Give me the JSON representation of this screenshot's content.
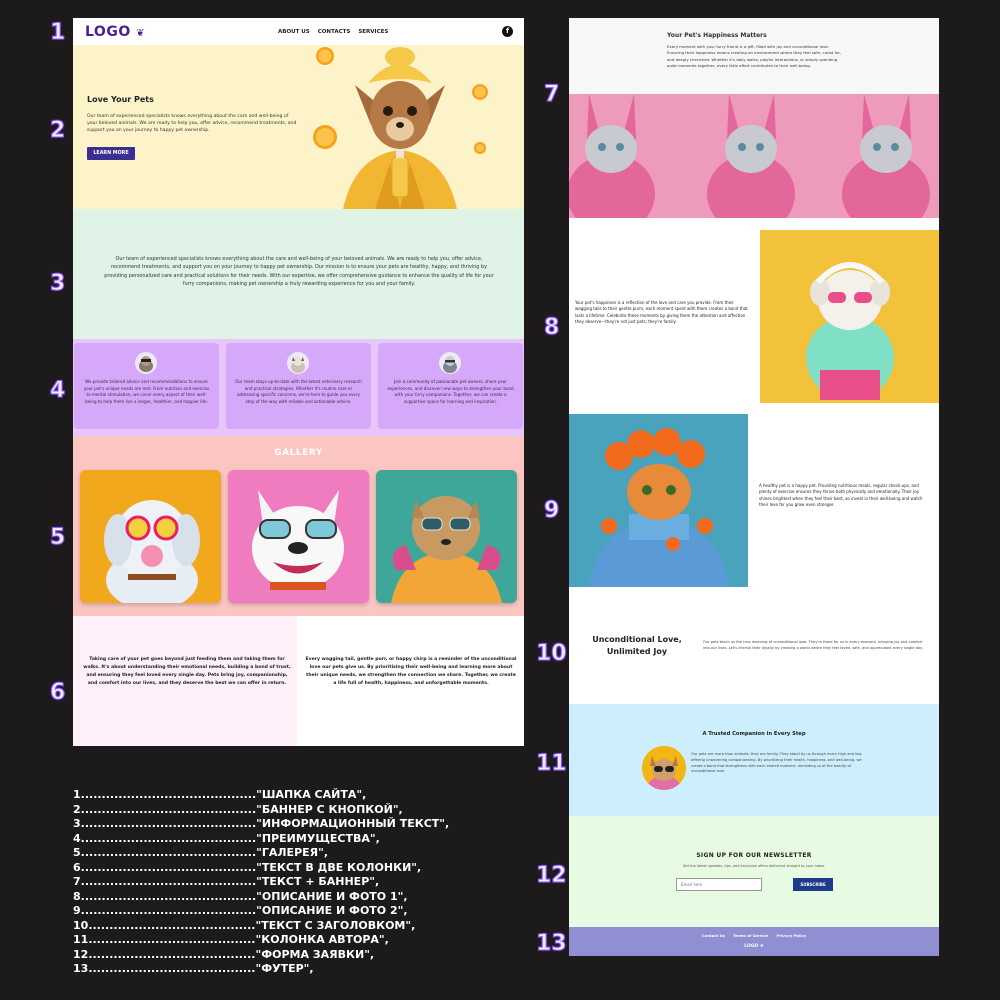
{
  "numbers": [
    "1",
    "2",
    "3",
    "4",
    "5",
    "6",
    "7",
    "8",
    "9",
    "10",
    "11",
    "12",
    "13"
  ],
  "header": {
    "logo": "LOGO",
    "nav": [
      "ABOUT US",
      "CONTACTS",
      "SERVICES"
    ],
    "social_icon": "f"
  },
  "banner": {
    "title": "Love Your Pets",
    "text": "Our team of experienced specialists knows everything about the care and well-being of your beloved animals. We are ready to help you, offer advice, recommend treatments, and support you on your journey to happy pet ownership.",
    "button": "LEARN MORE"
  },
  "info": {
    "text": "Our team of experienced specialists knows everything about the care and well-being of your beloved animals. We are ready to help you, offer advice, recommend treatments, and support you on your journey to happy pet ownership. Our mission is to ensure your pets are healthy, happy, and thriving by providing personalized care and practical solutions for their needs. With our expertise, we offer comprehensive guidance to enhance the quality of life for your furry companions, making pet ownership a truly rewarding experience for you and your family."
  },
  "advantages": [
    {
      "text": "We provide tailored advice and recommendations to ensure your pet's unique needs are met. From nutrition and exercise to mental stimulation, we cover every aspect of their well-being to help them live a longer, healthier, and happier life."
    },
    {
      "text": "Our team stays up-to-date with the latest veterinary research and practical strategies. Whether it's routine care or addressing specific concerns, we're here to guide you every step of the way with reliable and actionable advice."
    },
    {
      "text": "Join a community of passionate pet owners, share your experiences, and discover new ways to strengthen your bond with your furry companions. Together, we can create a supportive space for learning and inspiration."
    }
  ],
  "gallery": {
    "title": "GALLERY"
  },
  "two_col": {
    "left": "Taking care of your pet goes beyond just feeding them and taking them for walks. It's about understanding their emotional needs, building a bond of trust, and ensuring they feel loved every single day. Pets bring joy, companionship, and comfort into our lives, and they deserve the best we can offer in return.",
    "right": "Every wagging tail, gentle purr, or happy chirp is a reminder of the unconditional love our pets give us. By prioritizing their well-being and learning more about their unique needs, we strengthen the connection we share. Together, we create a life full of health, happiness, and unforgettable moments."
  },
  "happiness": {
    "title": "Your Pet's Happiness Matters",
    "text": "Every moment with your furry friend is a gift, filled with joy and unconditional love. Ensuring their happiness means creating an environment where they feel safe, cared for, and deeply cherished. Whether it's daily walks, playful interactions, or simply spending quiet moments together, every little effort contributes to their well-being."
  },
  "photo1": {
    "text": "Your pet's happiness is a reflection of the love and care you provide. From their wagging tails to their gentle purrs, each moment spent with them creates a bond that lasts a lifetime. Celebrate these moments by giving them the attention and affection they deserve—they're not just pets; they're family."
  },
  "photo2": {
    "text": "A healthy pet is a happy pet. Providing nutritious meals, regular check-ups, and plenty of exercise ensures they thrive both physically and emotionally. Their joy shines brightest when they feel their best, so invest in their well-being and watch their love for you grow even stronger."
  },
  "unconditional": {
    "title": "Unconditional Love, Unlimited Joy",
    "text": "Our pets teach us the true meaning of unconditional love. They're there for us in every moment, bringing joy and comfort into our lives. Let's cherish their loyalty by creating a world where they feel loved, safe, and appreciated every single day."
  },
  "author": {
    "title": "A Trusted Companion in Every Step",
    "text": "Our pets are more than animals; they are family. They stand by us through every high and low, offering unwavering companionship. By prioritizing their health, happiness, and well-being, we create a bond that strengthens with each shared moment, reminding us of the beauty of unconditional love."
  },
  "newsletter": {
    "title": "SIGN UP FOR OUR NEWSLETTER",
    "subtitle": "Get the latest updates, tips, and exclusive offers delivered straight to your inbox.",
    "placeholder": "Email here",
    "button": "SUBSCRIBE"
  },
  "footer": {
    "links": [
      "Contact Us",
      "Terms of Service",
      "Privacy Policy"
    ],
    "logo": "LOGO"
  },
  "legend": [
    {
      "num": "1",
      "dots": "..........................................",
      "label": "\"ШАПКА САЙТА\","
    },
    {
      "num": "2",
      "dots": "..........................................",
      "label": "\"БАННЕР С КНОПКОЙ\","
    },
    {
      "num": "3",
      "dots": "..........................................",
      "label": "\"ИНФОРМАЦИОННЫЙ ТЕКСТ\","
    },
    {
      "num": "4",
      "dots": "..........................................",
      "label": "\"ПРЕИМУЩЕСТВА\","
    },
    {
      "num": "5",
      "dots": "..........................................",
      "label": "\"ГАЛЕРЕЯ\","
    },
    {
      "num": "6",
      "dots": "..........................................",
      "label": "\"ТЕКСТ В ДВЕ КОЛОНКИ\","
    },
    {
      "num": "7",
      "dots": "..........................................",
      "label": "\"ТЕКСТ + БАННЕР\","
    },
    {
      "num": "8",
      "dots": "..........................................",
      "label": "\"ОПИСАНИЕ И ФОТО 1\","
    },
    {
      "num": "9",
      "dots": "..........................................",
      "label": "\"ОПИСАНИЕ И ФОТО 2\","
    },
    {
      "num": "10",
      "dots": "........................................",
      "label": "\"ТЕКСТ С ЗАГОЛОВКОМ\","
    },
    {
      "num": "11",
      "dots": "........................................",
      "label": "\"КОЛОНКА АВТОРА\","
    },
    {
      "num": "12",
      "dots": "........................................",
      "label": "\"ФОРМА ЗАЯВКИ\","
    },
    {
      "num": "13",
      "dots": "........................................",
      "label": "\"ФУТЕР\","
    }
  ],
  "colors": {
    "background": "#1c1a1b",
    "banner_bg": "#fdf3c9",
    "info_bg": "#dff3e6",
    "advantages_bg": "#e7c7fb",
    "gallery_bg": "#fbc6c2",
    "author_bg": "#cdeefc",
    "newsletter_bg": "#e6fbe1",
    "footer_bg": "#8f8fd2",
    "button_blue": "#3b2f8f"
  },
  "icons": [
    "facebook-icon"
  ]
}
